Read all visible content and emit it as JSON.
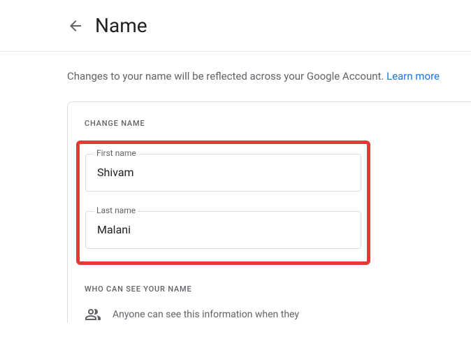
{
  "header": {
    "title": "Name"
  },
  "description": {
    "text": "Changes to your name will be reflected across your Google Account. ",
    "link": "Learn more"
  },
  "card": {
    "changeNameLabel": "CHANGE NAME",
    "firstName": {
      "label": "First name",
      "value": "Shivam"
    },
    "lastName": {
      "label": "Last name",
      "value": "Malani"
    },
    "visibilityLabel": "WHO CAN SEE YOUR NAME",
    "visibilityText": "Anyone can see this information when they"
  }
}
